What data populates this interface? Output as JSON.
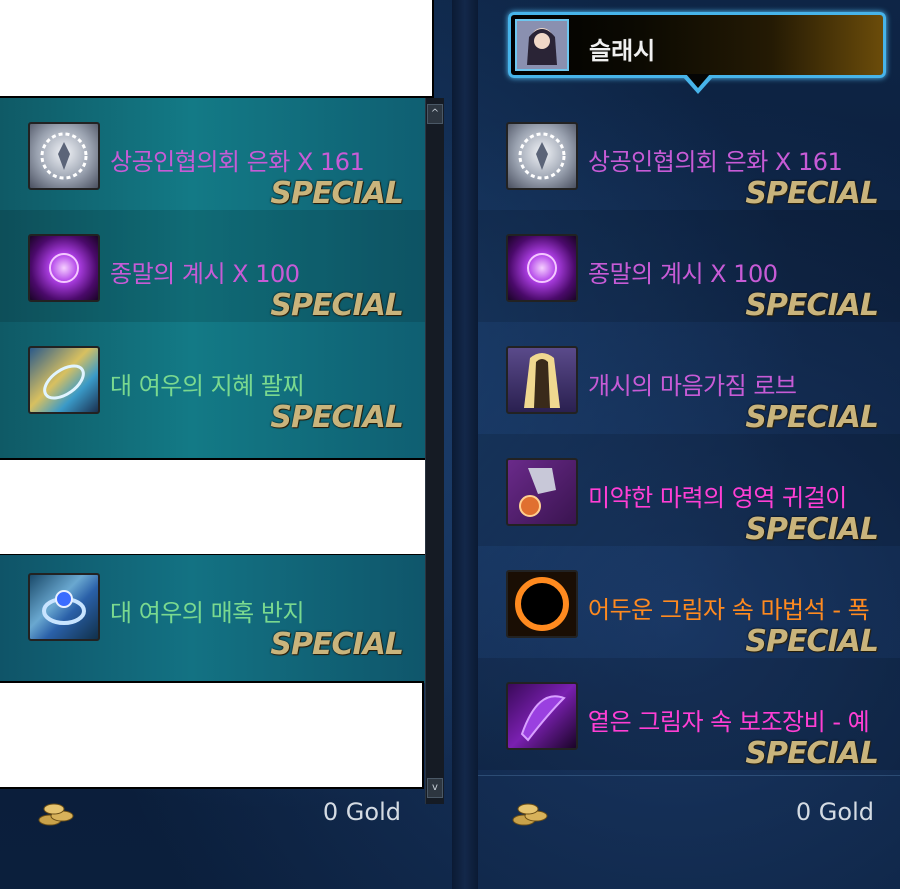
{
  "character": {
    "name": "슬래시"
  },
  "special_label": "SPECIAL",
  "left_items": [
    {
      "name": "상공인협의회 은화 X 161",
      "icon": "silver-coin-icon",
      "color": "#c75bd6"
    },
    {
      "name": "종말의 계시 X 100",
      "icon": "purple-orb-icon",
      "color": "#c75bd6"
    },
    {
      "name": "대 여우의 지혜 팔찌",
      "icon": "bracelet-icon",
      "color": "#7ad98f"
    },
    {
      "name": "대 여우의 매혹 반지",
      "icon": "ring-icon",
      "color": "#7ad98f"
    }
  ],
  "right_items": [
    {
      "name": "상공인협의회 은화 X 161",
      "icon": "silver-coin-icon",
      "color": "#c75bd6"
    },
    {
      "name": "종말의 계시 X 100",
      "icon": "purple-orb-icon",
      "color": "#c75bd6"
    },
    {
      "name": "개시의 마음가짐 로브",
      "icon": "robe-icon",
      "color": "#c75bd6"
    },
    {
      "name": "미약한 마력의 영역 귀걸이",
      "icon": "earring-icon",
      "color": "#ff3fd4"
    },
    {
      "name": "어두운 그림자 속 마법석 - 폭",
      "icon": "dark-ring-icon",
      "color": "#ff8a1f"
    },
    {
      "name": "옅은 그림자 속 보조장비 - 예",
      "icon": "shadow-gem-icon",
      "color": "#ff3fd4"
    }
  ],
  "gold": {
    "left": "0 Gold",
    "right": "0 Gold"
  },
  "scroll": {
    "up": "^",
    "down": "v"
  }
}
